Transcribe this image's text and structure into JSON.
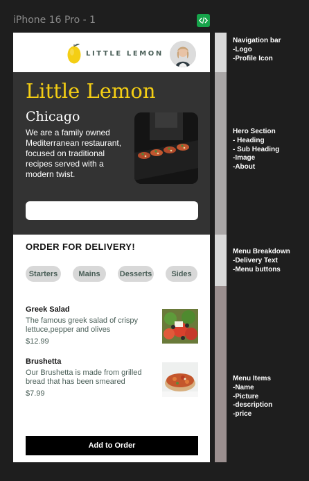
{
  "frame_label": "iPhone 16 Pro - 1",
  "nav": {
    "logo_text": "LITTLE LEMON"
  },
  "hero": {
    "heading": "Little Lemon",
    "subheading": "Chicago",
    "about": "We are a family owned Mediterranean restaurant, focused on traditional recipes served with a modern twist.",
    "search_value": ""
  },
  "menu": {
    "delivery_text": "ORDER FOR DELIVERY!",
    "categories": [
      "Starters",
      "Mains",
      "Desserts",
      "Sides"
    ]
  },
  "items": [
    {
      "name": "Greek Salad",
      "description": "The famous greek salad of crispy lettuce,pepper and olives",
      "price": "$12.99"
    },
    {
      "name": "Brushetta",
      "description": "Our Brushetta is made from grilled bread that has been smeared",
      "price": "$7.99"
    }
  ],
  "add_button": "Add to Order",
  "annotations": {
    "nav": [
      "Navigation bar",
      "-Logo",
      "-Profile Icon"
    ],
    "hero": [
      "Hero Section",
      "- Heading",
      "- Sub Heading",
      "-Image",
      "-About"
    ],
    "breakdown": [
      "Menu Breakdown",
      "-Delivery Text",
      "-Menu buttons"
    ],
    "items": [
      "Menu Items",
      "-Name",
      "-Picture",
      "-description",
      "-price"
    ]
  },
  "colors": {
    "primary_green": "#495e57",
    "primary_yellow": "#f4ce14",
    "hero_bg": "#333333"
  }
}
